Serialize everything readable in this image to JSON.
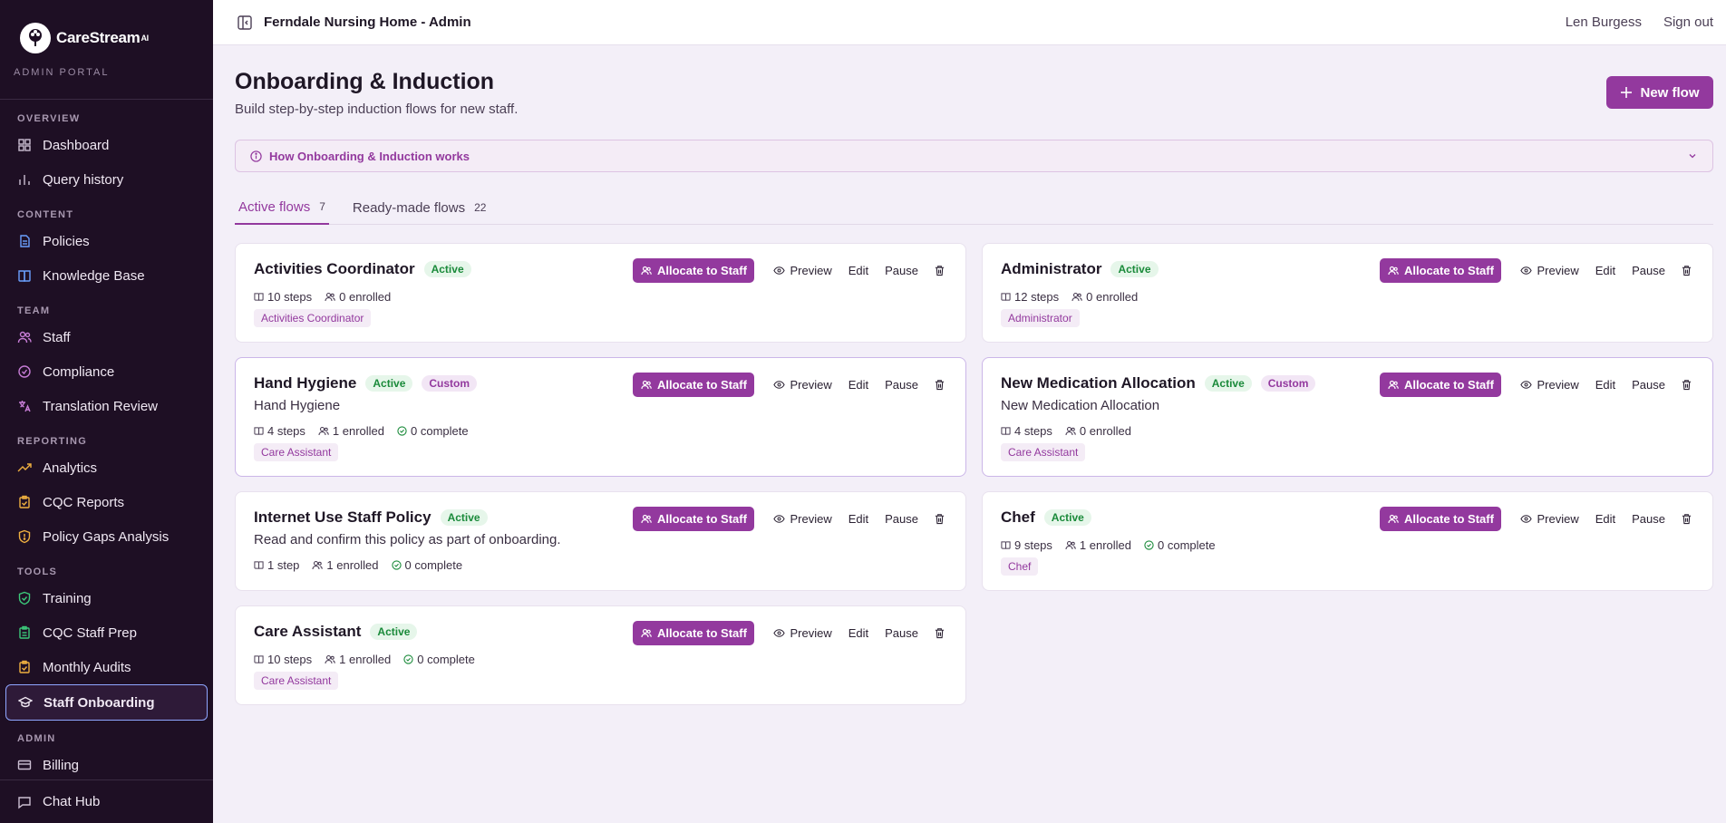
{
  "brand": {
    "name": "CareStream",
    "suffix": "AI",
    "portal": "ADMIN PORTAL"
  },
  "header": {
    "title": "Ferndale Nursing Home - Admin",
    "user": "Len Burgess",
    "signout": "Sign out"
  },
  "sidebar": {
    "sections": [
      {
        "label": "OVERVIEW",
        "items": [
          {
            "label": "Dashboard",
            "icon": "grid-icon"
          },
          {
            "label": "Query history",
            "icon": "bar-chart-icon"
          }
        ]
      },
      {
        "label": "CONTENT",
        "items": [
          {
            "label": "Policies",
            "icon": "document-icon"
          },
          {
            "label": "Knowledge Base",
            "icon": "book-icon"
          }
        ]
      },
      {
        "label": "TEAM",
        "items": [
          {
            "label": "Staff",
            "icon": "users-icon"
          },
          {
            "label": "Compliance",
            "icon": "check-circle-icon"
          },
          {
            "label": "Translation Review",
            "icon": "translate-icon"
          }
        ]
      },
      {
        "label": "REPORTING",
        "items": [
          {
            "label": "Analytics",
            "icon": "trending-up-icon"
          },
          {
            "label": "CQC Reports",
            "icon": "clipboard-check-icon"
          },
          {
            "label": "Policy Gaps Analysis",
            "icon": "shield-alert-icon"
          }
        ]
      },
      {
        "label": "TOOLS",
        "items": [
          {
            "label": "Training",
            "icon": "shield-check-icon"
          },
          {
            "label": "CQC Staff Prep",
            "icon": "clipboard-list-icon"
          },
          {
            "label": "Monthly Audits",
            "icon": "clipboard-check-icon"
          },
          {
            "label": "Staff Onboarding",
            "icon": "graduation-cap-icon",
            "active": true
          }
        ]
      },
      {
        "label": "ADMIN",
        "items": [
          {
            "label": "Billing",
            "icon": "card-icon"
          }
        ]
      }
    ],
    "bottom": {
      "label": "Chat Hub",
      "icon": "chat-icon"
    }
  },
  "page": {
    "title": "Onboarding & Induction",
    "subtitle": "Build step-by-step induction flows for new staff.",
    "new_flow": "New flow",
    "info": "How Onboarding & Induction works",
    "tabs": [
      {
        "label": "Active flows",
        "count": "7"
      },
      {
        "label": "Ready-made flows",
        "count": "22"
      }
    ]
  },
  "actions": {
    "allocate": "Allocate to Staff",
    "preview": "Preview",
    "edit": "Edit",
    "pause": "Pause"
  },
  "flows": [
    {
      "name": "Activities Coordinator",
      "status": "Active",
      "custom": "",
      "desc": "",
      "steps": "10 steps",
      "enrolled": "0 enrolled",
      "complete": "",
      "tag": "Activities Coordinator"
    },
    {
      "name": "Administrator",
      "status": "Active",
      "custom": "",
      "desc": "",
      "steps": "12 steps",
      "enrolled": "0 enrolled",
      "complete": "",
      "tag": "Administrator"
    },
    {
      "name": "Hand Hygiene",
      "status": "Active",
      "custom": "Custom",
      "desc": "Hand Hygiene",
      "steps": "4 steps",
      "enrolled": "1 enrolled",
      "complete": "0 complete",
      "tag": "Care Assistant"
    },
    {
      "name": "New Medication Allocation",
      "status": "Active",
      "custom": "Custom",
      "desc": "New Medication Allocation",
      "steps": "4 steps",
      "enrolled": "0 enrolled",
      "complete": "",
      "tag": "Care Assistant"
    },
    {
      "name": "Internet Use Staff Policy",
      "status": "Active",
      "custom": "",
      "desc": "Read and confirm this policy as part of onboarding.",
      "steps": "1 step",
      "enrolled": "1 enrolled",
      "complete": "0 complete",
      "tag": ""
    },
    {
      "name": "Chef",
      "status": "Active",
      "custom": "",
      "desc": "",
      "steps": "9 steps",
      "enrolled": "1 enrolled",
      "complete": "0 complete",
      "tag": "Chef"
    },
    {
      "name": "Care Assistant",
      "status": "Active",
      "custom": "",
      "desc": "",
      "steps": "10 steps",
      "enrolled": "1 enrolled",
      "complete": "0 complete",
      "tag": "Care Assistant"
    }
  ]
}
